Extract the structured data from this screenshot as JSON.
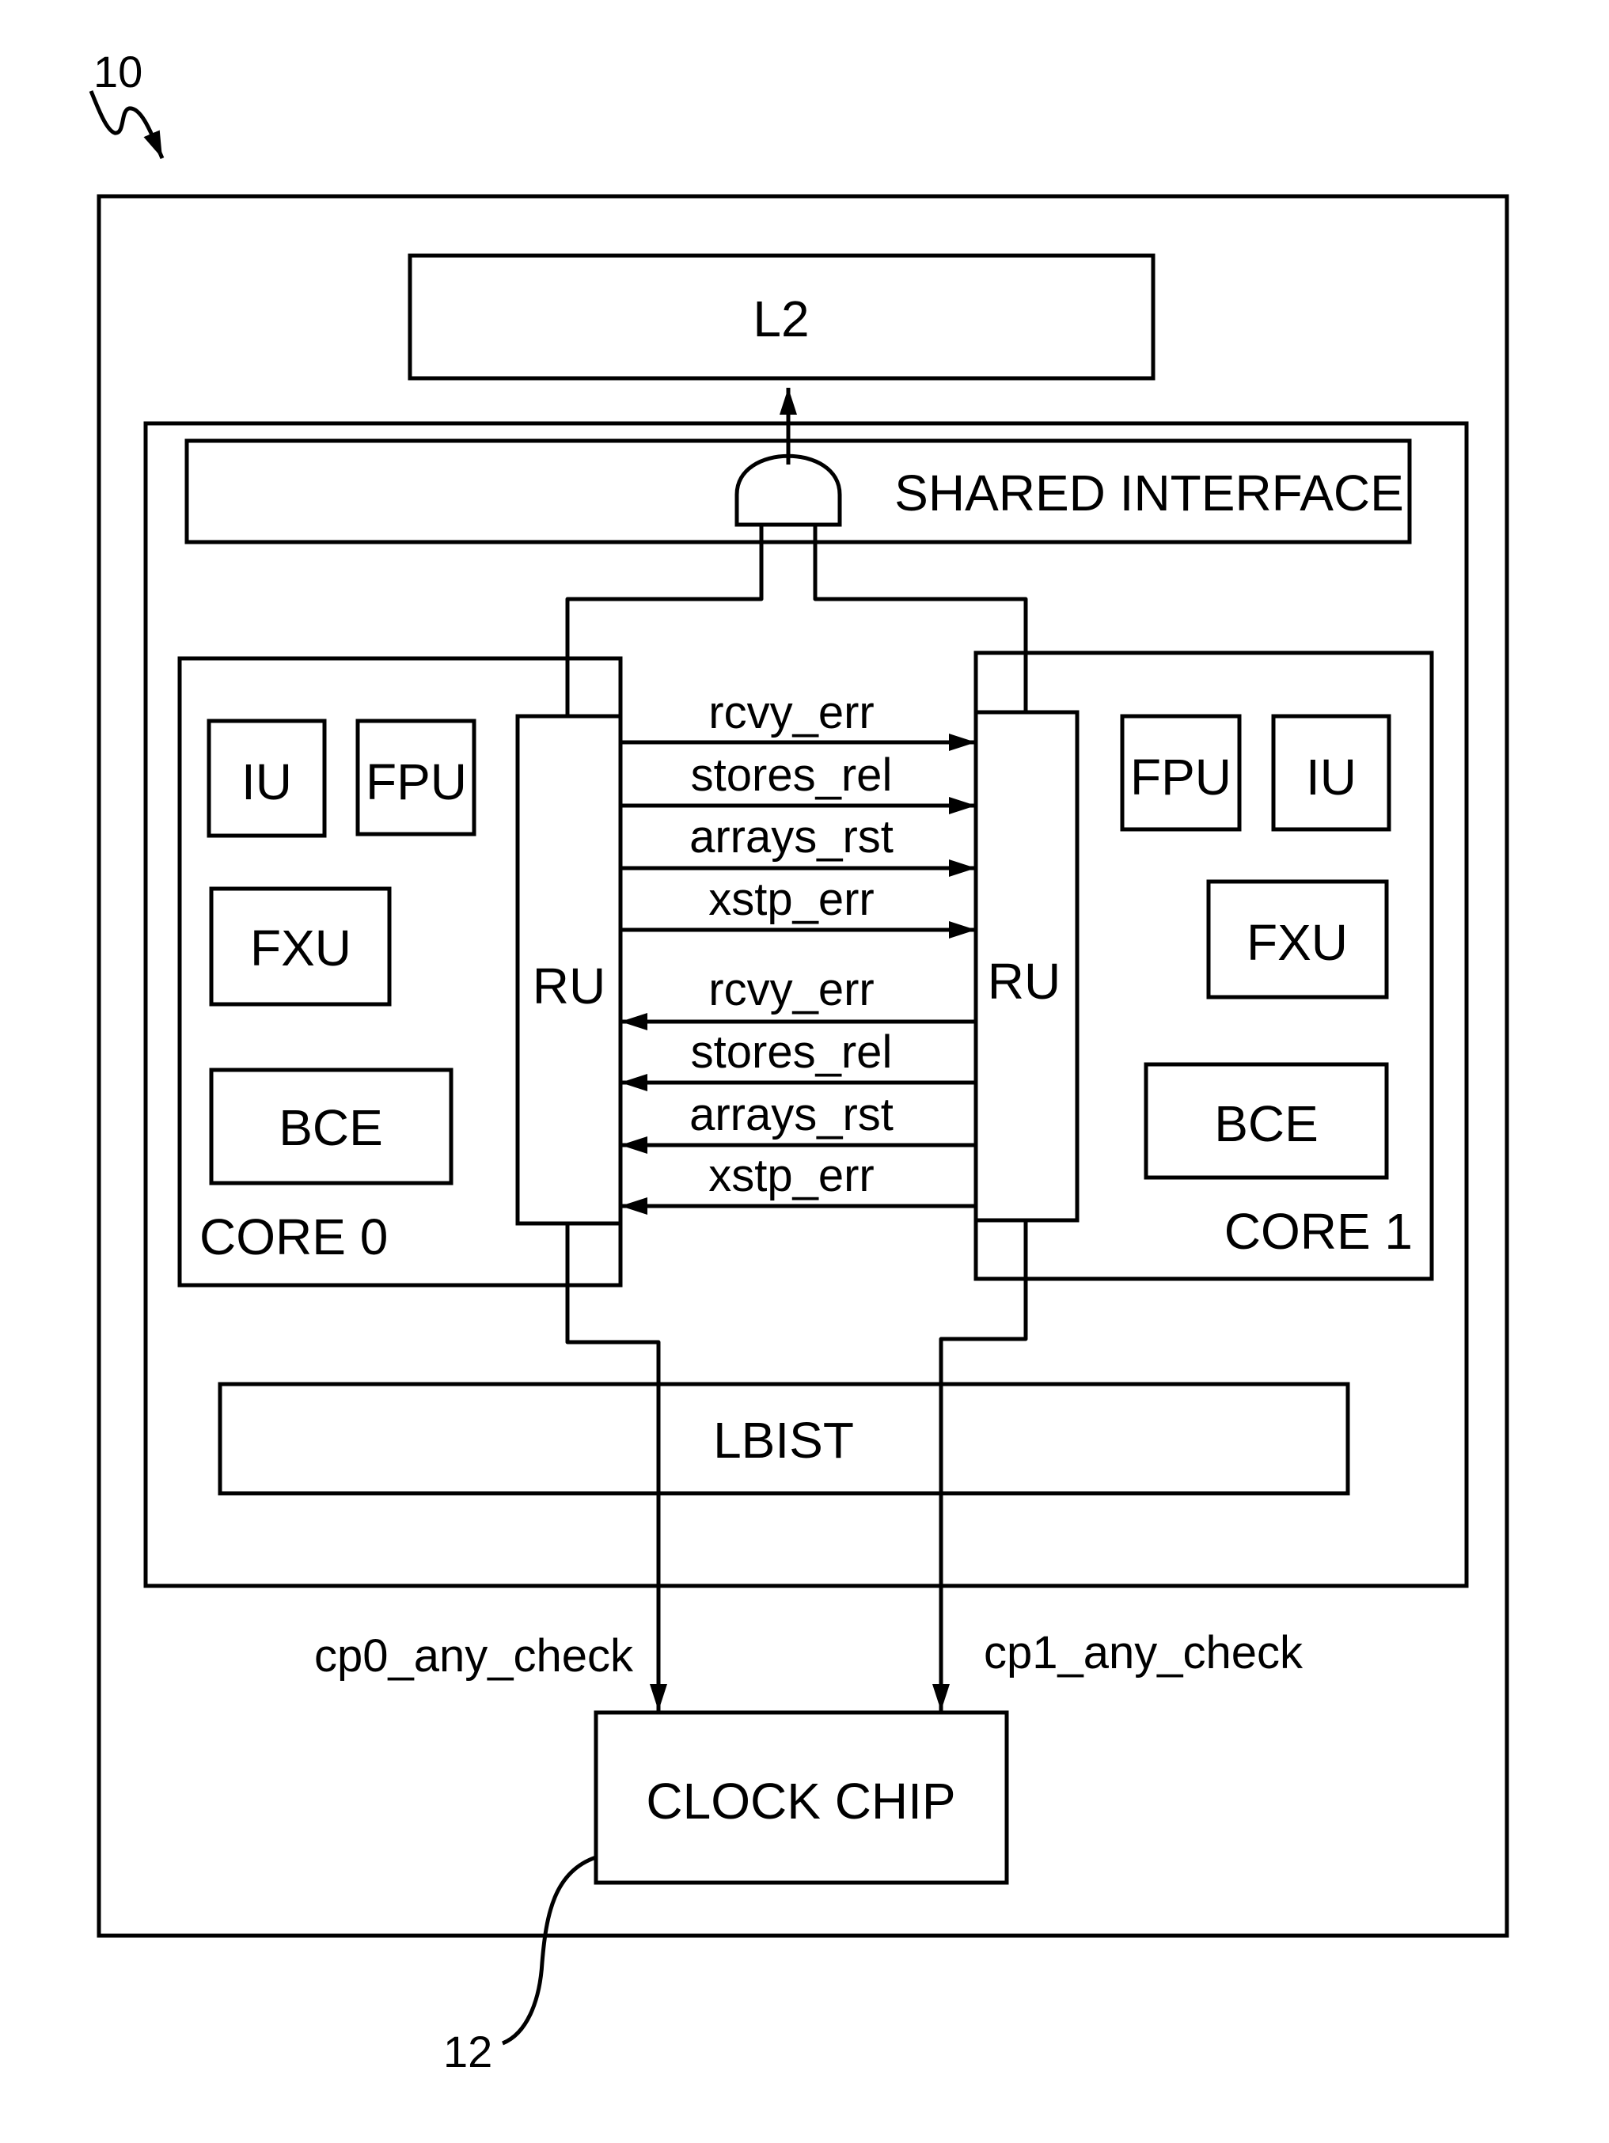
{
  "figure": {
    "reference_numeral": "10",
    "clock_chip_reference_numeral": "12"
  },
  "blocks": {
    "l2": "L2",
    "shared_interface": "SHARED INTERFACE",
    "lbist": "LBIST",
    "clock_chip": "CLOCK CHIP"
  },
  "core0": {
    "label": "CORE 0",
    "units": {
      "iu": "IU",
      "fpu": "FPU",
      "fxu": "FXU",
      "bce": "BCE",
      "ru": "RU"
    }
  },
  "core1": {
    "label": "CORE 1",
    "units": {
      "iu": "IU",
      "fpu": "FPU",
      "fxu": "FXU",
      "bce": "BCE",
      "ru": "RU"
    }
  },
  "signals": {
    "core0_to_core1": [
      "rcvy_err",
      "stores_rel",
      "arrays_rst",
      "xstp_err"
    ],
    "core1_to_core0": [
      "rcvy_err",
      "stores_rel",
      "arrays_rst",
      "xstp_err"
    ],
    "cp0_check": "cp0_any_check",
    "cp1_check": "cp1_any_check"
  }
}
